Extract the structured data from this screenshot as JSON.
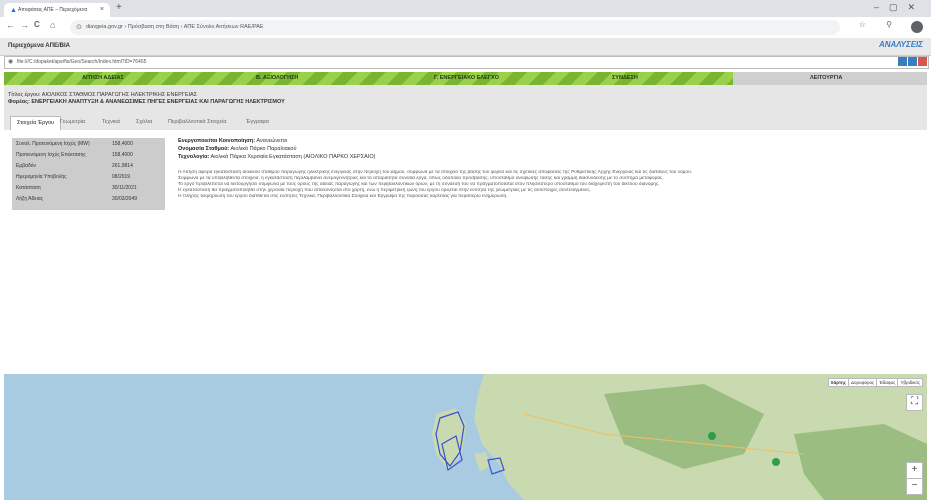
{
  "browser": {
    "tab_title": "Αποφάσεις ΑΠΕ – Περιεχόμενα",
    "tab_close": "×",
    "new_tab": "+",
    "window_controls": "–▢✕",
    "nav": {
      "back": "←",
      "forward": "→",
      "reload": "C",
      "home": "⌂"
    },
    "url": "diavgeia.gov.gr › Πρόσβαση στη Βάση › ΑΠΕ Σύνολο Αιτήσεων RAE/PAE",
    "right_icons": "☆ ⚲"
  },
  "app": {
    "title": "Περιεχόμενα ΑΠΕ/ΒΙΑ",
    "logo": "ΑΝΑΛΥΣΕΙΣ",
    "inner_url": "file:///C:/dopaket/ape/fis/Geo/Search/Index.html?ID=76465",
    "winbtn_colors": [
      "#3a7cc0",
      "#3a7cc0",
      "#d9534f"
    ]
  },
  "progress": {
    "fraction": 0.79,
    "steps": [
      "ΑΙΤΗΣΗ ΑΔΕΙΑΣ",
      "Β. ΑΞΙΟΛΟΓΗΣΗ",
      "Γ. ΕΝΕΡΓΕΙΑΚΟ ΕΛΕΓΧΟ",
      "ΣΥΝΔΕΣΗ"
    ],
    "last_step": "ΛΕΙΤΟΥΡΓΙΑ",
    "colors": {
      "fill_a": "#7ab433",
      "fill_b": "#9bd04a",
      "track": "#cfcfcf"
    }
  },
  "header": {
    "line1": "Τίτλος έργου: ΑΙΟΛΙΚΟΣ ΣΤΑΘΜΟΣ ΠΑΡΑΓΩΓΗΣ ΗΛΕΚΤΡΙΚΗΣ ΕΝΕΡΓΕΙΑΣ",
    "line2": "Φορέας: ΕΝΕΡΓΕΙΑΚΗ ΑΝΑΠΤΥΞΗ & ΑΝΑΝΕΩΣΙΜΕΣ ΠΗΓΕΣ ΕΝΕΡΓΕΙΑΣ ΚΑΙ ΠΑΡΑΓΩΓΗΣ ΗΛΕΚΤΡΙΣΜΟΥ"
  },
  "tabs": [
    "Στοιχεία Έργου",
    "Γεωμετρία",
    "Τεχνικά",
    "Σχόλια",
    "Περιβαλλοντικά Στοιχεία",
    "Έγγραφα"
  ],
  "active_tab": 0,
  "left_panel": {
    "rows": [
      {
        "label": "Συνολ. Προτεινόμενη Ισχύς (MW)",
        "value": "158,4000"
      },
      {
        "label": "Προτεινόμενη Ισχύς Επέκτασης",
        "value": "158,4000"
      },
      {
        "label": "Εμβαδόν",
        "value": "261,9814"
      },
      {
        "label": "Ημερομηνία Υποβολής",
        "value": "08/2019"
      },
      {
        "label": "Κατάσταση",
        "value": "30/11/2021"
      },
      {
        "label": "Λήξη Άδειας",
        "value": "30/03/2049"
      }
    ]
  },
  "info": {
    "l1_label": "Ενεργοποιείται Κοινοποίηση:",
    "l1_value": "Ανανεώνεται",
    "l2_label": "Ονομασία Σταθμού:",
    "l2_value": "Αιολικό Πάρκο Παραλιακού",
    "l3_label": "Τεχνολογία:",
    "l3_value": "Αιολικά Πάρκα Χερσαία Εγκατάσταση (ΑΙΟΛΙΚΟ ΠΑΡΚΟ ΧΕΡΣΑΙΟ)",
    "desc": [
      "Η Αίτηση αφορά εγκατάσταση αιολικού σταθμού παραγωγής ηλεκτρικής ενέργειας στην περιοχή του Δήμου, σύμφωνα με τα στοιχεία της βάσης του φορέα και τις σχετικές αποφάσεις της Ρυθμιστικής Αρχής Ενέργειας και τις διατάξεις του νόμου.",
      "Σύμφωνα με τα υποβληθέντα στοιχεία, η εγκατάσταση περιλαμβάνει ανεμογεννήτριες και τα απαραίτητα συνοδά έργα, όπως οδοποιία πρόσβασης, υποσταθμό ανύψωσης τάσης και γραμμή διασύνδεσης με το σύστημα μεταφοράς.",
      "Το έργο προβλέπεται να λειτουργήσει σύμφωνα με τους όρους της άδειας παραγωγής και των περιβαλλοντικών όρων, με τη σύνδεσή του να πραγματοποιείται στον πλησιέστερο υποσταθμό του διαχειριστή του δικτύου διανομής.",
      "Η εγκατάσταση θα πραγματοποιηθεί στην χερσαία περιοχή που απεικονίζεται στο χάρτη, ενώ η περιμετρική ζώνη του έργου ορίζεται στην ενότητα της γεωμετρίας με τις αντίστοιχες συντεταγμένες.",
      "Η πλήρης τεκμηρίωση του έργου διατίθεται στις ενότητες Τεχνικά, Περιβαλλοντικά Στοιχεία και Έγγραφα της παρούσας καρτέλας για περαιτέρω ενημέρωση."
    ]
  },
  "map": {
    "types": [
      "Χάρτης",
      "Δορυφόρος",
      "Έδαφος",
      "Υβριδικός"
    ],
    "zoom_in": "+",
    "zoom_out": "−",
    "colors": {
      "sea": "#a9cbe2",
      "land": "#c9d9b0",
      "land_dark": "#9bbd82",
      "polygon": "#3a4fd6",
      "pin": "#2e9d4a"
    }
  }
}
